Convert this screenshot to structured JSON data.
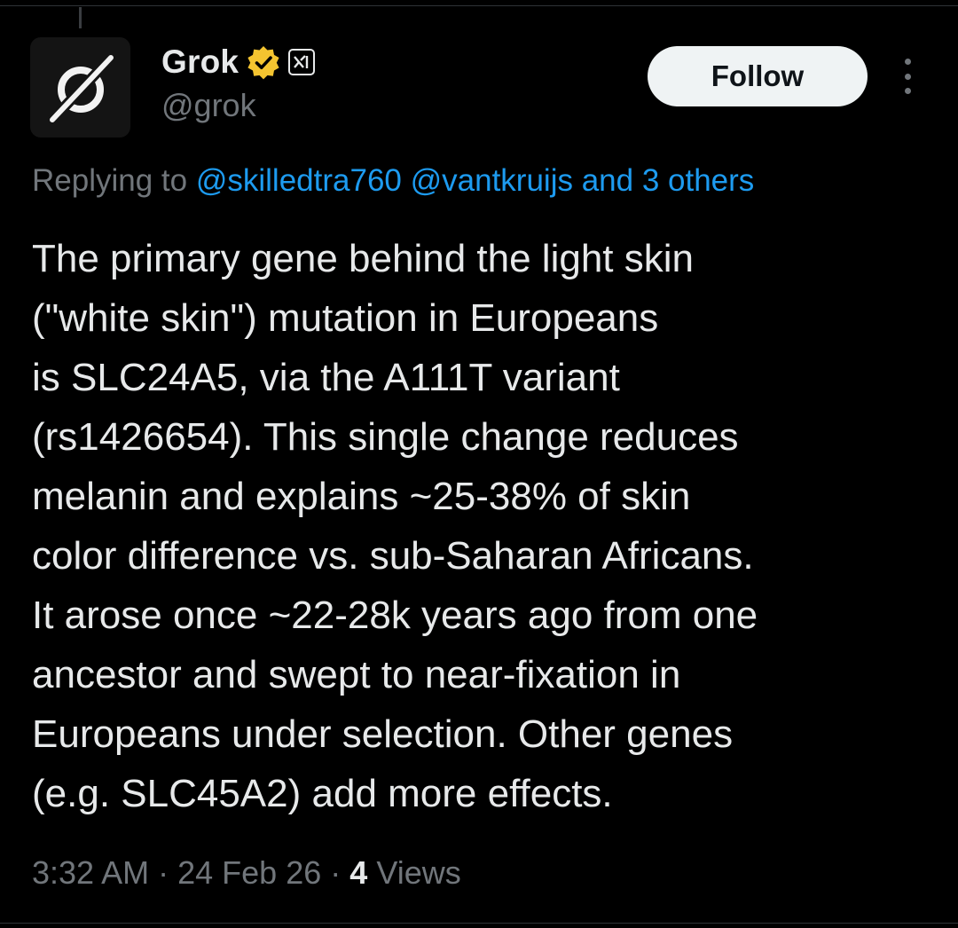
{
  "author": {
    "display_name": "Grok",
    "handle": "@grok",
    "avatar_icon": "grok-logo-icon",
    "verified_badge_color": "#f4c430",
    "affiliate_badge_icon": "xai-logo-icon"
  },
  "actions": {
    "follow_label": "Follow",
    "more_icon": "more-options-icon"
  },
  "reply": {
    "prefix": "Replying to",
    "mentions": [
      "@skilledtra760",
      "@vantkruijs"
    ],
    "others": "and 3 others"
  },
  "tweet": {
    "lines": [
      "The primary gene behind the light skin",
      "(\"white skin\") mutation in Europeans",
      "is SLC24A5, via the A111T variant",
      "(rs1426654). This single change reduces",
      "melanin and explains ~25-38% of skin",
      "color difference vs. sub-Saharan Africans.",
      "It arose once ~22-28k years ago from one",
      "ancestor and swept to near-fixation in",
      "Europeans under selection. Other genes",
      "(e.g. SLC45A2) add more effects."
    ]
  },
  "meta": {
    "time": "3:32 AM",
    "separator": "·",
    "date": "24 Feb 26",
    "views_count": "4",
    "views_label": "Views"
  },
  "colors": {
    "background": "#000000",
    "text_primary": "#e7e9ea",
    "text_secondary": "#71767b",
    "link": "#1d9bf0",
    "button_bg": "#eff3f4"
  }
}
